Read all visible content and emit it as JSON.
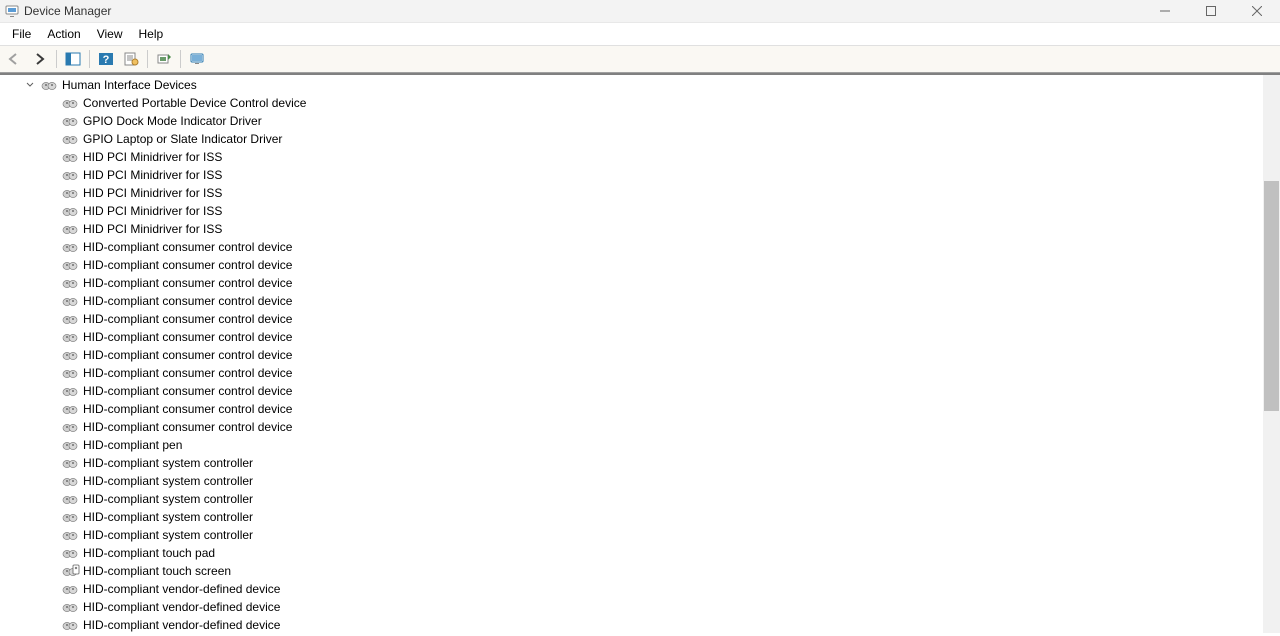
{
  "window": {
    "title": "Device Manager"
  },
  "menu": {
    "items": [
      "File",
      "Action",
      "View",
      "Help"
    ]
  },
  "toolbar": {
    "back": "Back",
    "forward": "Forward",
    "show_hide": "Show/Hide Console Tree",
    "help": "Help",
    "properties": "Properties",
    "scan": "Scan for hardware changes",
    "monitor": "Devices and Printers"
  },
  "tree": {
    "category": "Human Interface Devices",
    "devices": [
      "Converted Portable Device Control device",
      "GPIO Dock Mode Indicator Driver",
      "GPIO Laptop or Slate Indicator Driver",
      "HID PCI Minidriver for ISS",
      "HID PCI Minidriver for ISS",
      "HID PCI Minidriver for ISS",
      "HID PCI Minidriver for ISS",
      "HID PCI Minidriver for ISS",
      "HID-compliant consumer control device",
      "HID-compliant consumer control device",
      "HID-compliant consumer control device",
      "HID-compliant consumer control device",
      "HID-compliant consumer control device",
      "HID-compliant consumer control device",
      "HID-compliant consumer control device",
      "HID-compliant consumer control device",
      "HID-compliant consumer control device",
      "HID-compliant consumer control device",
      "HID-compliant consumer control device",
      "HID-compliant pen",
      "HID-compliant system controller",
      "HID-compliant system controller",
      "HID-compliant system controller",
      "HID-compliant system controller",
      "HID-compliant system controller",
      "HID-compliant touch pad",
      "HID-compliant touch screen",
      "HID-compliant vendor-defined device",
      "HID-compliant vendor-defined device",
      "HID-compliant vendor-defined device"
    ]
  }
}
